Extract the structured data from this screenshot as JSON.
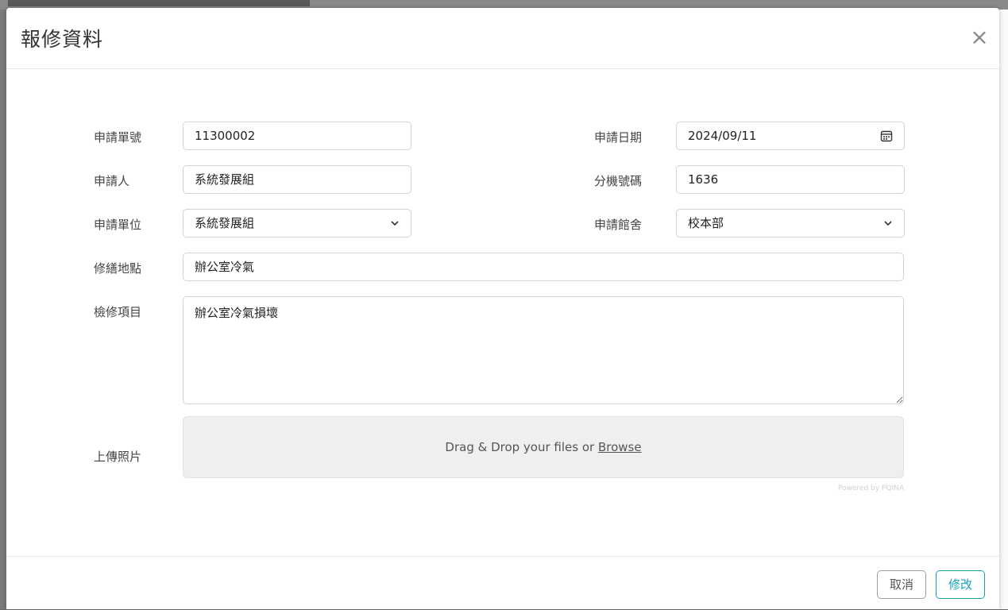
{
  "modal": {
    "title": "報修資料",
    "close_glyph": "×"
  },
  "form": {
    "application_no": {
      "label": "申請單號",
      "value": "11300002"
    },
    "application_date": {
      "label": "申請日期",
      "value": "2024/09/11",
      "icon": "calendar-icon"
    },
    "applicant": {
      "label": "申請人",
      "value": "系統發展組"
    },
    "extension": {
      "label": "分機號碼",
      "value": "1636"
    },
    "unit": {
      "label": "申請單位",
      "selected": "系統發展組"
    },
    "campus": {
      "label": "申請館舍",
      "selected": "校本部"
    },
    "location": {
      "label": "修繕地點",
      "value": "辦公室冷氣"
    },
    "items": {
      "label": "檢修項目",
      "value": "辦公室冷氣損壞"
    },
    "upload": {
      "label": "上傳照片",
      "prompt": "Drag & Drop your files or ",
      "browse": "Browse",
      "credit": "Powered by PQINA"
    }
  },
  "footer": {
    "cancel_label": "取消",
    "submit_label": "修改"
  },
  "colors": {
    "accent": "#17a2b8",
    "border": "#ced4da"
  }
}
